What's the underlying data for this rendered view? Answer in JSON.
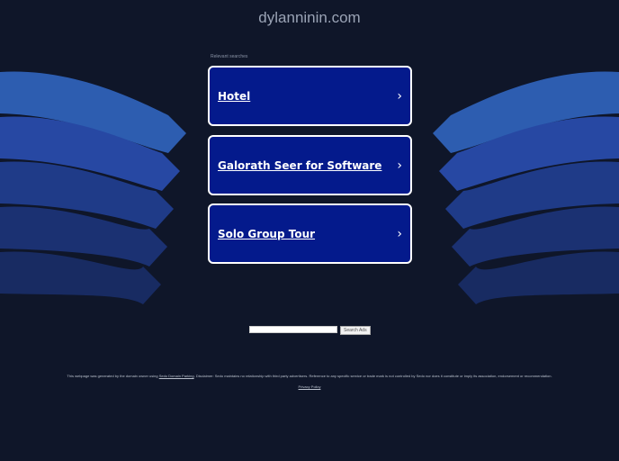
{
  "header": {
    "title": "dylanninin.com"
  },
  "related": {
    "label": "Relevant searches",
    "items": [
      {
        "label": "Hotel"
      },
      {
        "label": "Galorath Seer for Software"
      },
      {
        "label": "Solo Group Tour"
      }
    ]
  },
  "search": {
    "button": "Search Ads",
    "value": ""
  },
  "footer": {
    "pre": "This webpage was generated by the domain owner using ",
    "link": "Sedo Domain Parking",
    "post": ". Disclaimer: Sedo maintains no relationship with third party advertisers. Reference to any specific service or trade mark is not controlled by Sedo nor does it constitute or imply its association, endorsement or recommendation.",
    "privacy": "Privacy Policy"
  },
  "colors": {
    "background": "#0f1629",
    "card": "#041a8c",
    "bands": [
      "#2d5db0",
      "#2748a3",
      "#1f3b88",
      "#1b3172",
      "#182b62"
    ]
  }
}
